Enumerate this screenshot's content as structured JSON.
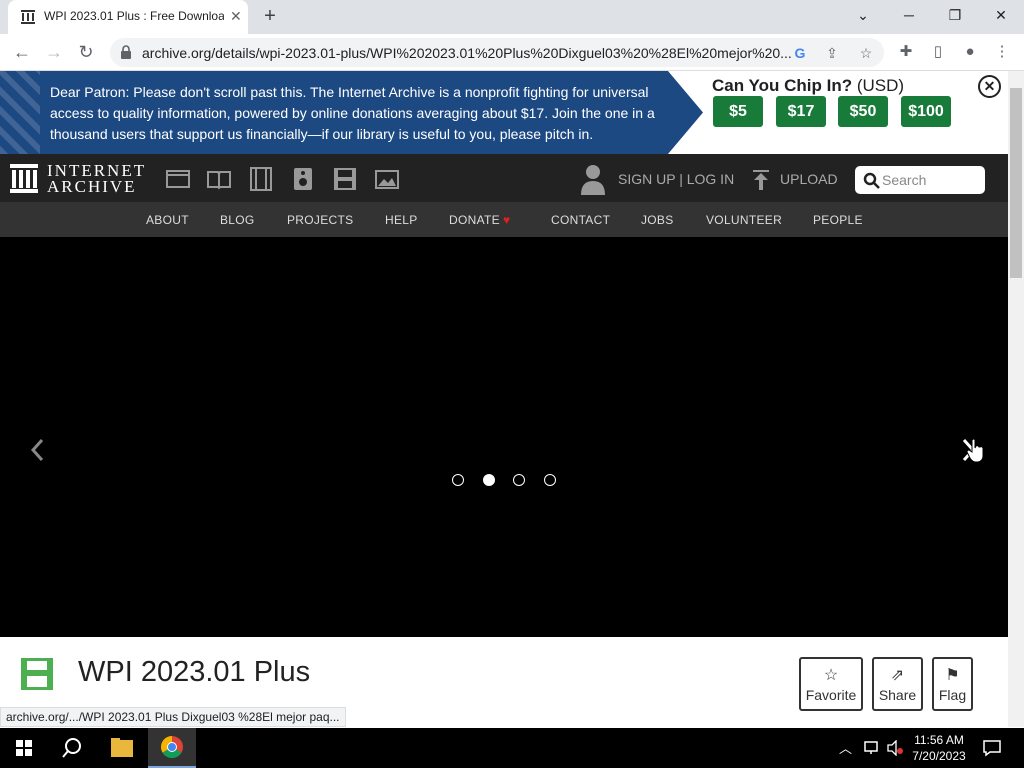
{
  "browser": {
    "tab_title": "WPI 2023.01 Plus : Free Downloa",
    "url": "archive.org/details/wpi-2023.01-plus/WPI%202023.01%20Plus%20Dixguel03%20%28El%20mejor%20...",
    "status_url": "archive.org/.../WPI 2023.01 Plus Dixguel03 %28El mejor paq..."
  },
  "banner": {
    "message": "Dear Patron: Please don't scroll past this. The Internet Archive is a nonprofit fighting for universal access to quality information, powered by online donations averaging about $17. Join the one in a thousand users that support us financially—if our library is useful to you, please pitch in.",
    "chip_bold": "Can You Chip In?",
    "chip_currency": "(USD)",
    "amounts": [
      "$5",
      "$17",
      "$50",
      "$100"
    ],
    "colors": {
      "banner_bg": "#1d4982",
      "amount_bg": "#197b3a"
    }
  },
  "header": {
    "logo_line1": "INTERNET",
    "logo_line2": "ARCHIVE",
    "signup": "SIGN UP | LOG IN",
    "upload": "UPLOAD",
    "search_placeholder": "Search"
  },
  "nav": [
    "ABOUT",
    "BLOG",
    "PROJECTS",
    "HELP",
    "DONATE",
    "CONTACT",
    "JOBS",
    "VOLUNTEER",
    "PEOPLE"
  ],
  "carousel": {
    "slides": 4,
    "active_index": 1
  },
  "item": {
    "title": "WPI 2023.01 Plus",
    "actions": [
      "Favorite",
      "Share",
      "Flag"
    ]
  },
  "taskbar": {
    "time": "11:56 AM",
    "date": "7/20/2023"
  }
}
